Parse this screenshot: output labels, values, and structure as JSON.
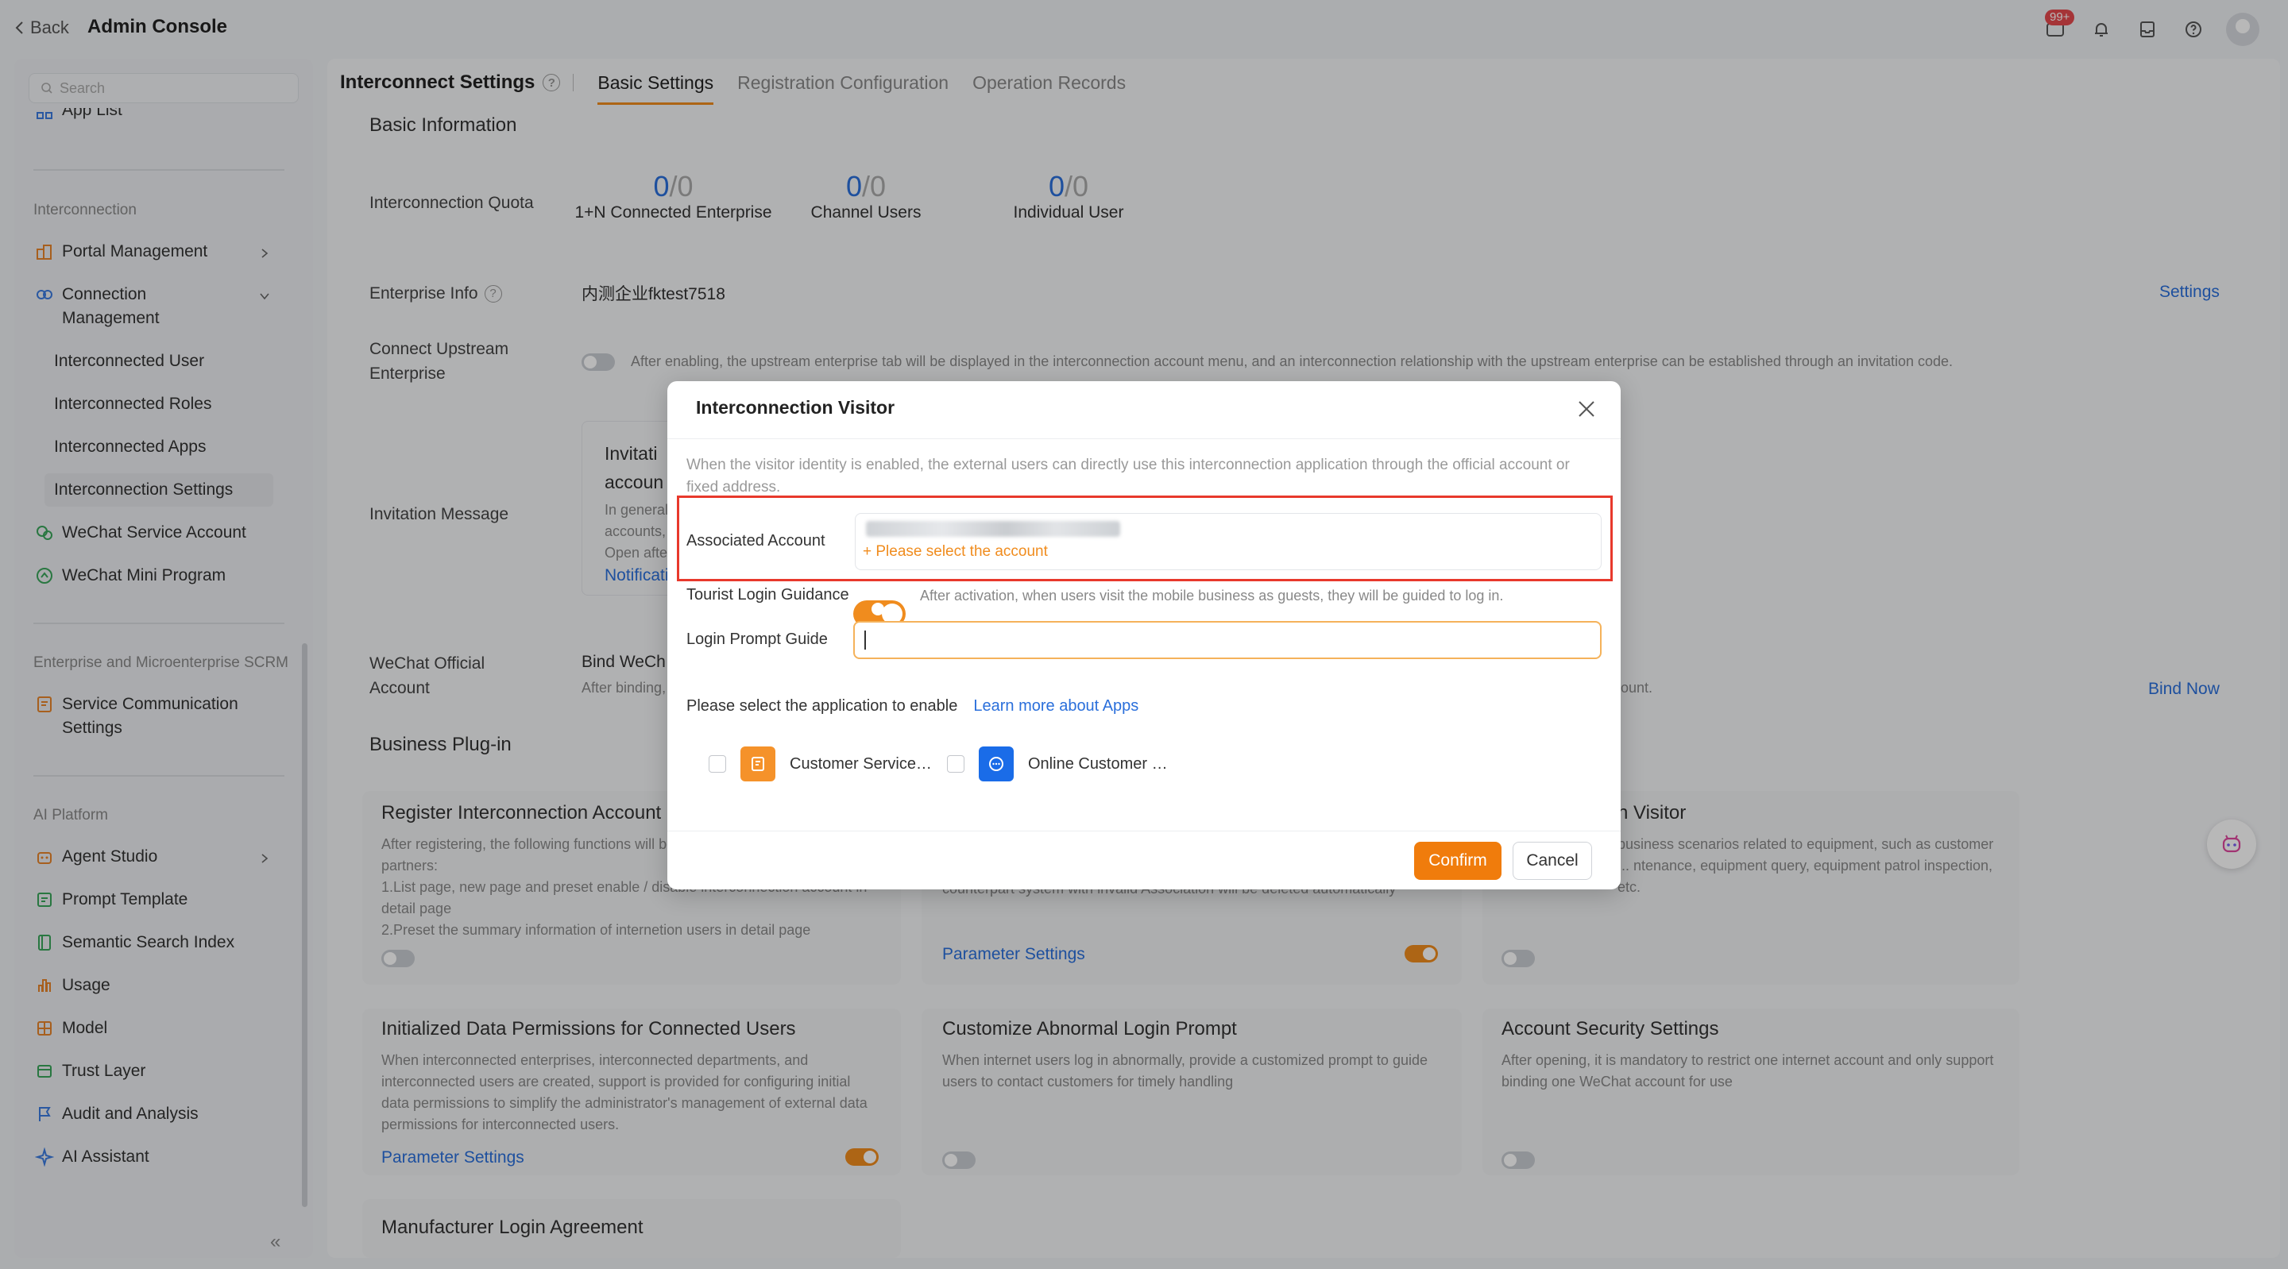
{
  "header": {
    "back_label": "Back",
    "title": "Admin Console",
    "badge": "99+"
  },
  "sidebar": {
    "search_placeholder": "Search",
    "app_list": "App List",
    "group_interconnection": "Interconnection",
    "portal_management": "Portal Management",
    "connection_management": "Connection Management",
    "interconnected_user": "Interconnected User",
    "interconnected_roles": "Interconnected Roles",
    "interconnected_apps": "Interconnected Apps",
    "interconnection_settings": "Interconnection Settings",
    "wechat_service_account": "WeChat Service Account",
    "wechat_mini_program": "WeChat Mini Program",
    "group_scrm": "Enterprise and Microenterprise SCRM",
    "service_communication_settings": "Service Communication Settings",
    "group_ai": "AI Platform",
    "agent_studio": "Agent Studio",
    "prompt_template": "Prompt Template",
    "semantic_search_index": "Semantic Search Index",
    "usage": "Usage",
    "model": "Model",
    "trust_layer": "Trust Layer",
    "audit_analysis": "Audit and Analysis",
    "ai_assistant": "AI Assistant"
  },
  "tabs": {
    "page_title": "Interconnect Settings",
    "basic": "Basic Settings",
    "registration": "Registration Configuration",
    "records": "Operation Records"
  },
  "basic": {
    "section_title": "Basic Information",
    "quota_label": "Interconnection Quota",
    "quota": [
      {
        "used": "0",
        "total": "/0",
        "label": "1+N Connected Enterprise"
      },
      {
        "used": "0",
        "total": "/0",
        "label": "Channel Users"
      },
      {
        "used": "0",
        "total": "/0",
        "label": "Individual User"
      }
    ],
    "enterprise_info_label": "Enterprise Info",
    "enterprise_name": "内测企业fktest7518",
    "settings_link": "Settings",
    "connect_upstream_label": "Connect Upstream Enterprise",
    "connect_upstream_desc": "After enabling, the upstream enterprise tab will be displayed in the interconnection account menu, and an interconnection relationship with the upstream enterprise can be established through an invitation code.",
    "invitation_label": "Invitation Message",
    "invitation_title_partial": "Invitati",
    "invitation_title_partial2": "accoun",
    "invitation_desc_partial": [
      "In general",
      "accounts,",
      "Open afte"
    ],
    "invitation_link_partial": "Notificati",
    "wechat_official_label": "WeChat Official Account",
    "wechat_bind_partial": "Bind WeCh",
    "wechat_desc_partial": "After binding,",
    "wechat_desc_tail": "ount.",
    "bind_now": "Bind Now"
  },
  "plugin": {
    "section_title": "Business Plug-in",
    "cards": [
      {
        "title": "Register Interconnection Account",
        "desc": "After registering, the following functions will be ... such as accounts and partners:\n1.List page, new page and preset enable / disable interconnection account in detail page\n2.Preset the summary information of internetion users in detail page"
      },
      {
        "title_partial": "n Visitor",
        "desc_partial": "business scenarios related to equipment, such as customer ... ntenance, equipment query, equipment patrol inspection, etc."
      },
      {
        "title": "Initialized Data Permissions for Connected Users",
        "desc": "When interconnected enterprises, interconnected departments, and interconnected users are created, support is provided for configuring initial data permissions to simplify the administrator's management of external data permissions for interconnected users.",
        "link": "Parameter Settings"
      },
      {
        "title": "Customize Abnormal Login Prompt",
        "desc": "When internet users log in abnormally, provide a customized prompt to guide users to contact customers for timely handling"
      },
      {
        "title": "Account Security Settings",
        "desc": "After opening, it is mandatory to restrict one internet account and only support binding one WeChat account for use"
      },
      {
        "title": "Manufacturer Login Agreement"
      }
    ],
    "middle_link": "Parameter Settings",
    "middle_desc_partial": "counterpart system with invalid Association will be deleted automatically"
  },
  "modal": {
    "title": "Interconnection Visitor",
    "note": "When the visitor identity is enabled, the external users can directly use this interconnection application through the official account or fixed address.",
    "associated_account_label": "Associated Account",
    "select_account": "+ Please select the account",
    "tourist_label": "Tourist Login Guidance",
    "tourist_desc": "After activation, when users visit the mobile business as guests, they will be guided to log in.",
    "login_prompt_label": "Login Prompt Guide",
    "apps_label": "Please select the application to enable",
    "apps_link": "Learn more about Apps",
    "apps": [
      {
        "name": "Customer Service…"
      },
      {
        "name": "Online Customer …"
      }
    ],
    "confirm": "Confirm",
    "cancel": "Cancel"
  },
  "colors": {
    "accent": "#f08c1e",
    "link": "#2a6fdb",
    "danger": "#e8392c"
  }
}
